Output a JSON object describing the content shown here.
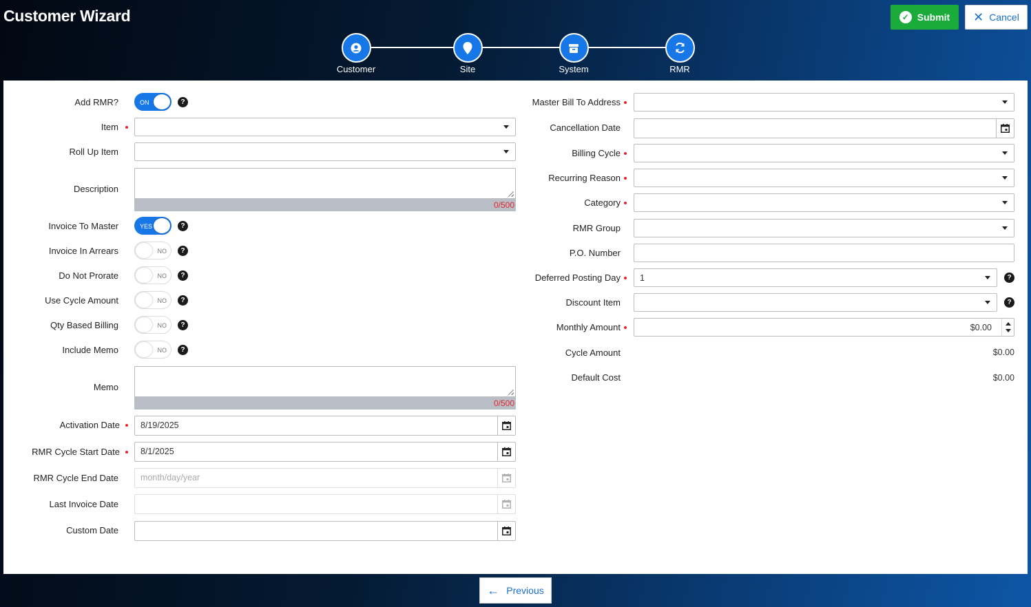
{
  "app": {
    "title": "Customer Wizard"
  },
  "header": {
    "submit_label": "Submit",
    "cancel_label": "Cancel"
  },
  "steps": [
    {
      "label": "Customer",
      "icon": "user-icon"
    },
    {
      "label": "Site",
      "icon": "map-pin-icon"
    },
    {
      "label": "System",
      "icon": "box-icon"
    },
    {
      "label": "RMR",
      "icon": "refresh-icon"
    }
  ],
  "left": {
    "add_rmr": {
      "label": "Add RMR?",
      "state": "ON"
    },
    "item": {
      "label": "Item",
      "value": ""
    },
    "roll_up_item": {
      "label": "Roll Up Item",
      "value": ""
    },
    "description": {
      "label": "Description",
      "count": "0/500"
    },
    "invoice_to_master": {
      "label": "Invoice To Master",
      "state": "YES"
    },
    "invoice_in_arrears": {
      "label": "Invoice In Arrears",
      "state": "NO"
    },
    "do_not_prorate": {
      "label": "Do Not Prorate",
      "state": "NO"
    },
    "use_cycle_amount": {
      "label": "Use Cycle Amount",
      "state": "NO"
    },
    "qty_based_billing": {
      "label": "Qty Based Billing",
      "state": "NO"
    },
    "include_memo": {
      "label": "Include Memo",
      "state": "NO"
    },
    "memo": {
      "label": "Memo",
      "count": "0/500"
    },
    "activation_date": {
      "label": "Activation Date",
      "value": "8/19/2025"
    },
    "rmr_cycle_start_date": {
      "label": "RMR Cycle Start Date",
      "value": "8/1/2025"
    },
    "rmr_cycle_end_date": {
      "label": "RMR Cycle End Date",
      "placeholder": "month/day/year"
    },
    "last_invoice_date": {
      "label": "Last Invoice Date",
      "value": ""
    },
    "custom_date": {
      "label": "Custom Date",
      "value": ""
    }
  },
  "right": {
    "master_bill_to_address": {
      "label": "Master Bill To Address",
      "value": ""
    },
    "cancellation_date": {
      "label": "Cancellation Date",
      "value": ""
    },
    "billing_cycle": {
      "label": "Billing Cycle",
      "value": ""
    },
    "recurring_reason": {
      "label": "Recurring Reason",
      "value": ""
    },
    "category": {
      "label": "Category",
      "value": ""
    },
    "rmr_group": {
      "label": "RMR Group",
      "value": ""
    },
    "po_number": {
      "label": "P.O. Number",
      "value": ""
    },
    "deferred_posting_day": {
      "label": "Deferred Posting Day",
      "value": "1"
    },
    "discount_item": {
      "label": "Discount Item",
      "value": ""
    },
    "monthly_amount": {
      "label": "Monthly Amount",
      "value": "$0.00"
    },
    "cycle_amount": {
      "label": "Cycle Amount",
      "value": "$0.00"
    },
    "default_cost": {
      "label": "Default Cost",
      "value": "$0.00"
    }
  },
  "footer": {
    "previous_label": "Previous"
  },
  "colors": {
    "accent": "#1877e6",
    "submit": "#1aab3a",
    "required": "#e0262b"
  }
}
